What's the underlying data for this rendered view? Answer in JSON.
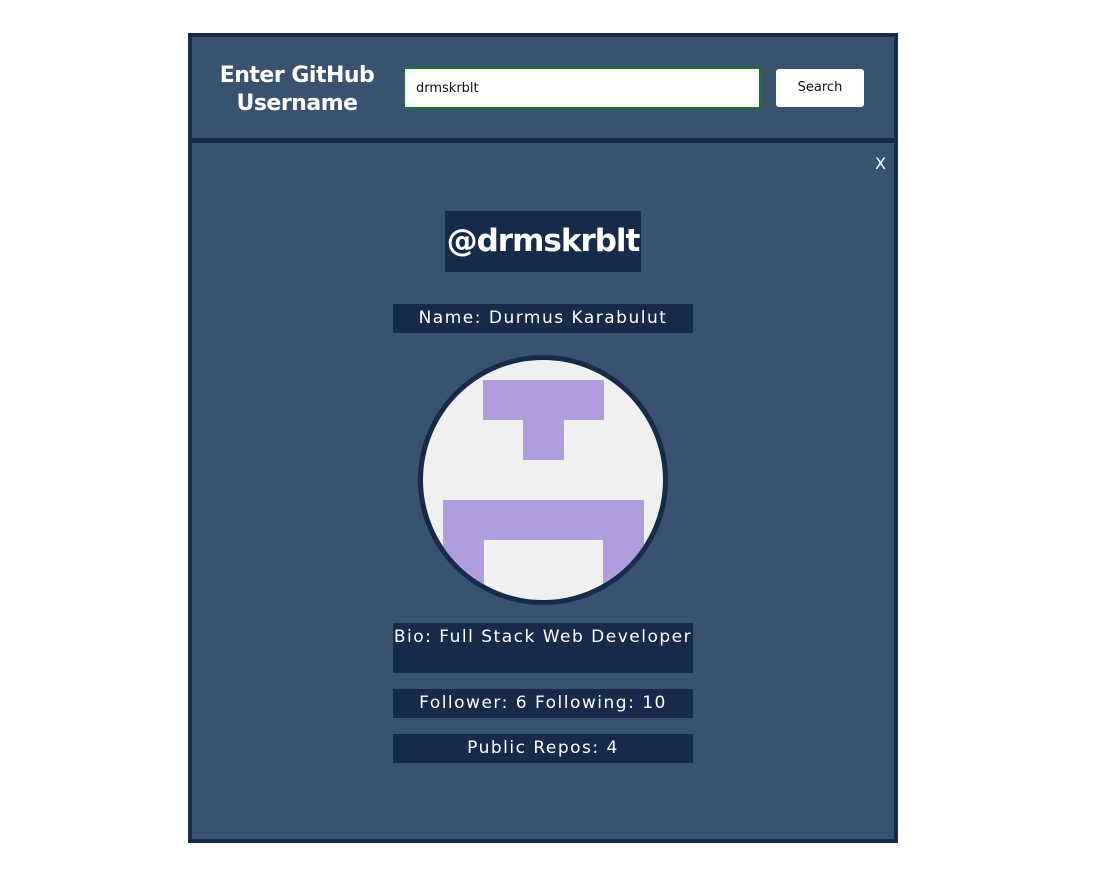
{
  "header": {
    "title": "Enter GitHub Username",
    "search_value": "drmskrblt",
    "search_button_label": "Search"
  },
  "profile": {
    "close_label": "X",
    "username": "@drmskrblt",
    "name": "Name: Durmus Karabulut",
    "bio": "Bio: Full Stack Web Developer",
    "followers": "Follower: 6 Following: 10",
    "repos": "Public Repos: 4",
    "avatar_icon": "identicon-avatar"
  },
  "colors": {
    "frame": "#162b4a",
    "panel": "#38526f",
    "input_border": "#137a2c",
    "avatar_bg": "#f0f0f0",
    "avatar_fg": "#b19ce0"
  }
}
